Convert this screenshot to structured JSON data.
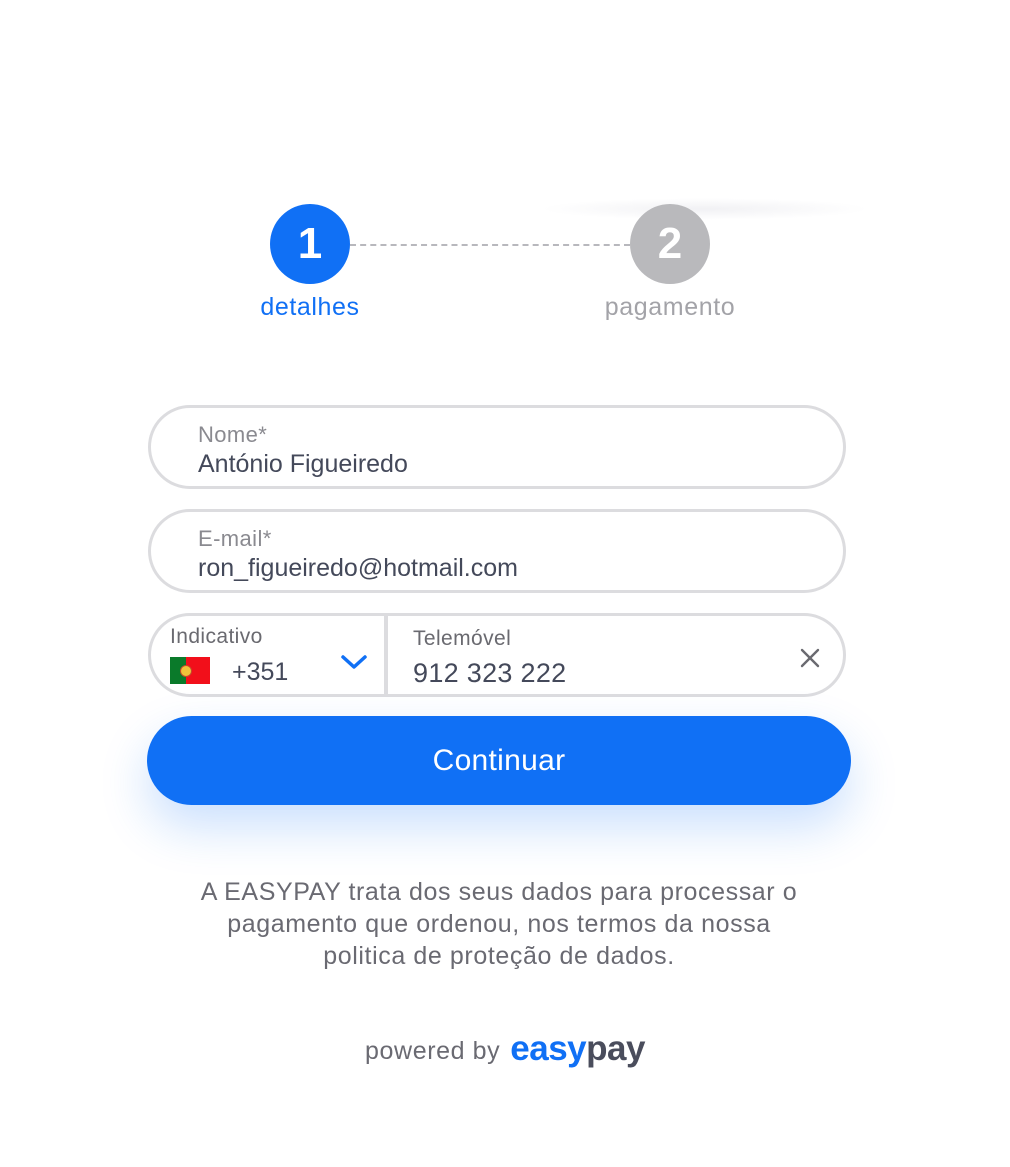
{
  "stepper": {
    "steps": [
      {
        "number": "1",
        "label": "detalhes",
        "state": "active"
      },
      {
        "number": "2",
        "label": "pagamento",
        "state": "inactive"
      }
    ]
  },
  "form": {
    "nome": {
      "label": "Nome*",
      "value": "António Figueiredo"
    },
    "email": {
      "label": "E-mail*",
      "value": "ron_figueiredo@hotmail.com"
    },
    "indicativo": {
      "label": "Indicativo",
      "value": "+351",
      "flag": "portugal-flag-icon"
    },
    "telemovel": {
      "label": "Telemóvel",
      "value": "912 323 222"
    }
  },
  "continue_label": "Continuar",
  "disclaimer": [
    "A EASYPAY trata dos seus dados para processar o",
    "pagamento que ordenou, nos termos da nossa",
    "politica de proteção de dados."
  ],
  "footer": {
    "powered_by": "powered by",
    "logo_easy": "easy",
    "logo_pay": "pay"
  },
  "colors": {
    "accent": "#1070f5",
    "inactive": "#b9b9bc",
    "border": "#dcdcdf",
    "text": "#44495a"
  }
}
